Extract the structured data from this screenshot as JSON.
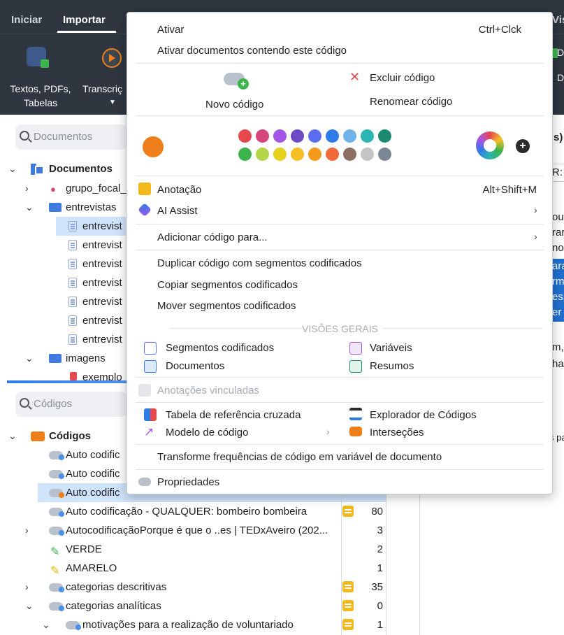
{
  "topbar": {
    "tabs": [
      "Iniciar",
      "Importar"
    ],
    "right_tab_fragment": "Vis"
  },
  "ribbon": {
    "btn_textos": "Textos, PDFs,",
    "btn_textos_2": "Tabelas",
    "btn_transcricao": "Transcriç",
    "right_frag_1": "D",
    "right_frag_2": "D"
  },
  "documents_panel": {
    "search_placeholder": "Documentos",
    "root": "Documentos",
    "items": [
      {
        "label": "grupo_focal_"
      },
      {
        "label": "entrevistas"
      },
      {
        "label": "entrevist"
      },
      {
        "label": "entrevist"
      },
      {
        "label": "entrevist"
      },
      {
        "label": "entrevist"
      },
      {
        "label": "entrevist"
      },
      {
        "label": "entrevist"
      },
      {
        "label": "entrevist"
      },
      {
        "label": "imagens"
      },
      {
        "label": "exemplo"
      }
    ]
  },
  "codes_panel": {
    "search_placeholder": "Códigos",
    "root": "Códigos",
    "rows": [
      {
        "label": "Auto codific",
        "count": ""
      },
      {
        "label": "Auto codific",
        "count": ""
      },
      {
        "label": "Auto codific",
        "count": ""
      },
      {
        "label": "Auto codificação - QUALQUER: bombeiro bombeira",
        "count": "80"
      },
      {
        "label": "AutocodificaçãoPorque é que o ..es | TEDxAveiro (202...",
        "count": "3"
      },
      {
        "label": "VERDE",
        "count": "2"
      },
      {
        "label": "AMARELO",
        "count": "1"
      },
      {
        "label": "categorias descritivas",
        "count": "35"
      },
      {
        "label": "categorias analíticas",
        "count": "0"
      },
      {
        "label": "motivações para a realização de voluntariado",
        "count": "1"
      }
    ]
  },
  "right_panel": {
    "frag_s": "s)",
    "frag_r": "R:",
    "frag_lines": [
      "ou",
      "rar",
      "nos",
      "ara",
      "rm",
      "esp",
      "er a"
    ],
    "frag_m": "m,",
    "frag_ha": "ha",
    "frag_spa": "s pa"
  },
  "menu": {
    "activate": "Ativar",
    "activate_shortcut": "Ctrl+Clck",
    "activate_docs": "Ativar documentos contendo este código",
    "new_code": "Novo código",
    "delete_code": "Excluir código",
    "rename_code": "Renomear código",
    "selected_color": "#ef7f1a",
    "palette_row1": [
      "#e5484d",
      "#d6457b",
      "#a356e6",
      "#6c4cc2",
      "#5b6ef2",
      "#2f7be8",
      "#6fb3ea",
      "#2bb5b0",
      "#1b8a6f"
    ],
    "palette_row2": [
      "#3cb44b",
      "#b5d64a",
      "#e6d21e",
      "#f5c026",
      "#f59a1a",
      "#f26a3b",
      "#8d6e63",
      "#c4c4c4",
      "#7b8794"
    ],
    "memo": "Anotação",
    "memo_shortcut": "Alt+Shift+M",
    "ai_assist": "AI Assist",
    "add_code_to": "Adicionar código para...",
    "duplicate": "Duplicar código com segmentos codificados",
    "copy_segments": "Copiar segmentos codificados",
    "move_segments": "Mover segmentos codificados",
    "overviews_header": "VISÕES GERAIS",
    "ov_segments": "Segmentos codificados",
    "ov_variables": "Variáveis",
    "ov_documents": "Documentos",
    "ov_summaries": "Resumos",
    "linked_memos": "Anotações vinculadas",
    "crosstab": "Tabela de referência cruzada",
    "code_explorer": "Explorador de Códigos",
    "code_model": "Modelo de código",
    "intersections": "Interseções",
    "transform": "Transforme frequências de código em variável de documento",
    "properties": "Propriedades"
  }
}
